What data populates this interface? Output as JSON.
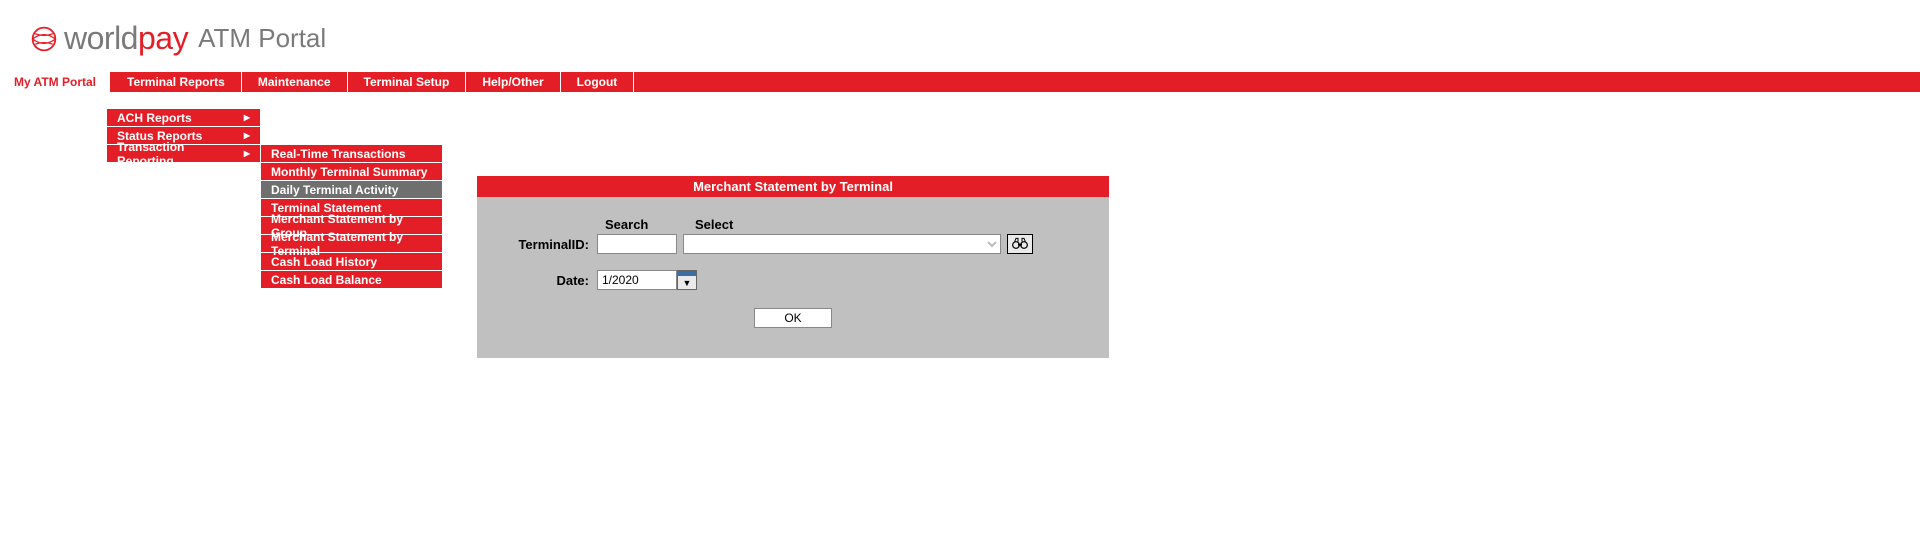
{
  "logo": {
    "world": "world",
    "pay": "pay",
    "tagline": "ATM Portal"
  },
  "mainnav": {
    "items": [
      "My ATM Portal",
      "Terminal Reports",
      "Maintenance",
      "Terminal Setup",
      "Help/Other",
      "Logout"
    ]
  },
  "submenu1": {
    "items": [
      "ACH Reports",
      "Status Reports",
      "Transaction Reporting"
    ]
  },
  "submenu2": {
    "items": [
      "Real-Time Transactions",
      "Monthly Terminal Summary",
      "Daily Terminal Activity",
      "Terminal Statement",
      "Merchant Statement by Group",
      "Merchant Statement by Terminal",
      "Cash Load History",
      "Cash Load Balance"
    ],
    "highlight_index": 2
  },
  "panel": {
    "title": "Merchant Statement by Terminal",
    "cols": {
      "search": "Search",
      "select": "Select"
    },
    "labels": {
      "terminal_id": "TerminalID:",
      "date": "Date:"
    },
    "values": {
      "search_value": "",
      "select_value": "",
      "date_value": "1/2020"
    },
    "buttons": {
      "ok": "OK"
    }
  }
}
